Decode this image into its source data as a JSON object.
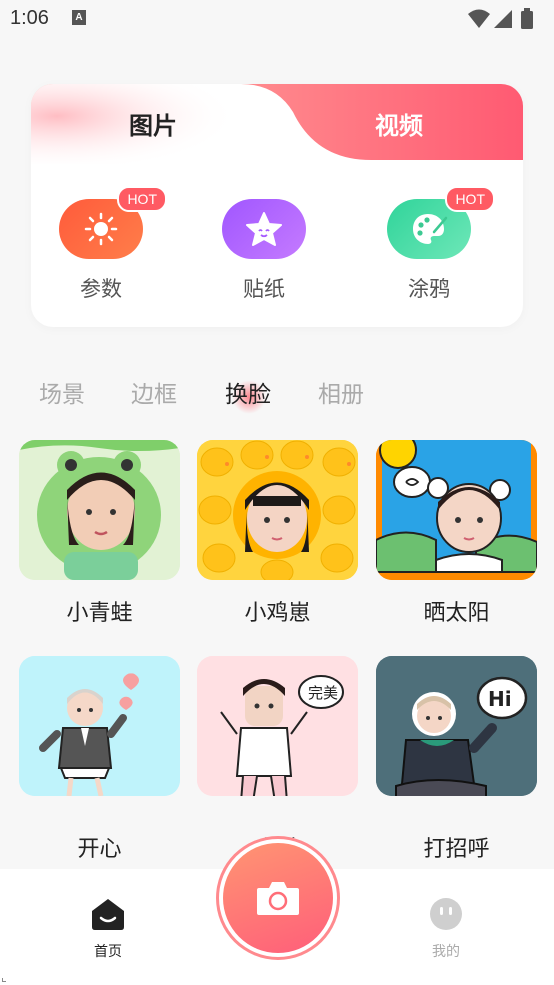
{
  "status": {
    "time": "1:06",
    "notif_letter": "A"
  },
  "card": {
    "tabs": [
      {
        "label": "图片"
      },
      {
        "label": "视频"
      }
    ],
    "tools": [
      {
        "label": "参数",
        "badge": "HOT",
        "icon": "sun-icon",
        "color": "#ff6a3d"
      },
      {
        "label": "贴纸",
        "badge": "",
        "icon": "star-face-icon",
        "color": "#b56bff"
      },
      {
        "label": "涂鸦",
        "badge": "HOT",
        "icon": "palette-icon",
        "color": "#3ed6a0"
      }
    ]
  },
  "categories": [
    "场景",
    "边框",
    "换脸",
    "相册"
  ],
  "active_category": "换脸",
  "templates": [
    {
      "label": "小青蛙",
      "theme": "frog"
    },
    {
      "label": "小鸡崽",
      "theme": "chick"
    },
    {
      "label": "晒太阳",
      "theme": "sun"
    },
    {
      "label": "开心",
      "theme": "happy"
    },
    {
      "label": "完美",
      "theme": "perfect"
    },
    {
      "label": "打招呼",
      "theme": "hi"
    }
  ],
  "stickers": {
    "perfect": "完美",
    "hi": "Hi"
  },
  "nav": {
    "home": "首页",
    "mine": "我的"
  },
  "colors": {
    "accent": "#ff5a6e",
    "gradient_start": "#ff9a7a",
    "gradient_end": "#ff5a72"
  }
}
